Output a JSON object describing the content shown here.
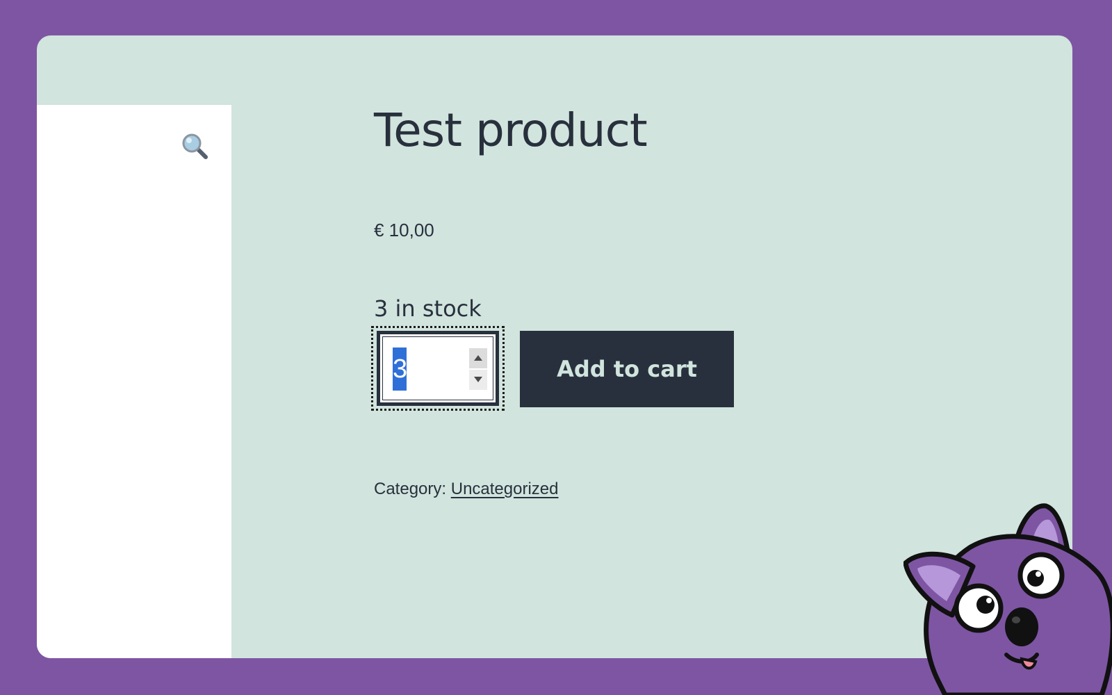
{
  "colors": {
    "frame_background": "#7e55a3",
    "card_background": "#d1e4dd",
    "gallery_background": "#ffffff",
    "text": "#28303d",
    "button_background": "#28303d",
    "button_text": "#d1e4dd",
    "selection": "#2f6fd8"
  },
  "gallery": {
    "zoom_icon": "magnifying-glass-icon"
  },
  "product": {
    "title": "Test product",
    "price": "€ 10,00",
    "stock": "3 in stock",
    "quantity": "3",
    "add_to_cart_label": "Add to cart",
    "category_label": "Category:",
    "category_link": "Uncategorized"
  },
  "mascot": {
    "icon": "purple-cartoon-fox-mascot"
  }
}
